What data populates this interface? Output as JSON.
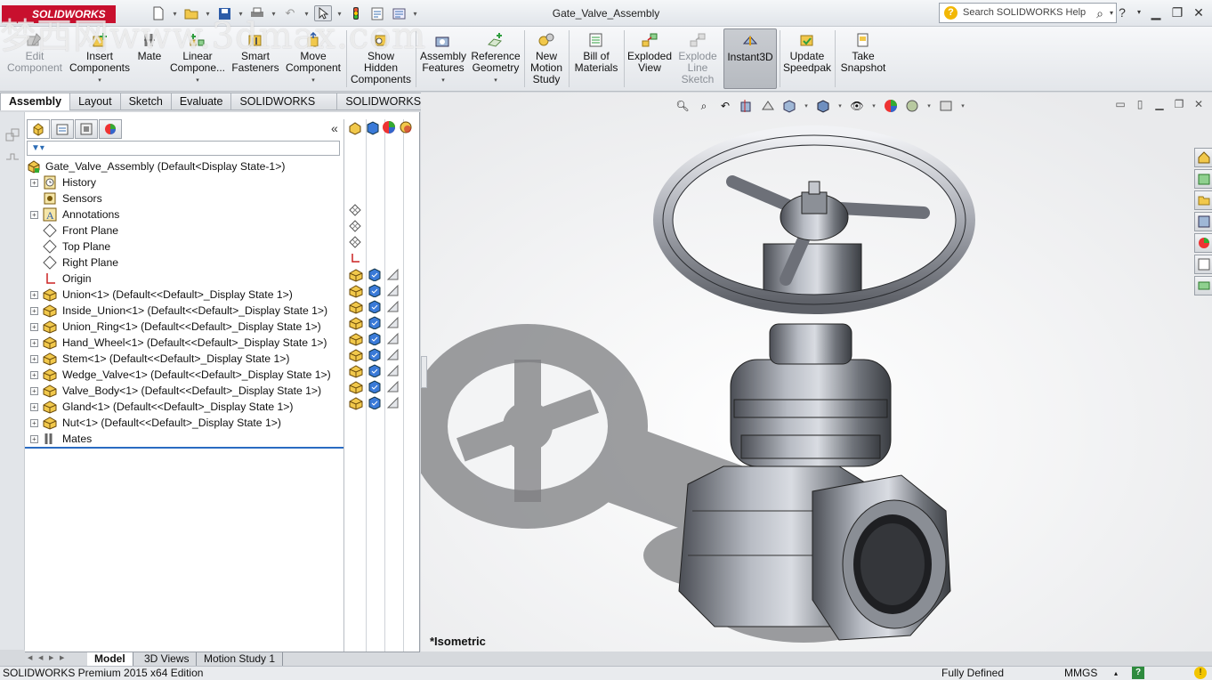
{
  "window": {
    "title": "Gate_Valve_Assembly",
    "logo_text": "SOLIDWORKS",
    "search_placeholder": "Search SOLIDWORKS Help",
    "watermark": "梦西网www.3dmax.com"
  },
  "quick_access": {
    "icons": [
      "new-icon",
      "open-icon",
      "save-icon",
      "print-icon",
      "undo-icon",
      "select-icon",
      "rebuild-icon",
      "file-properties-icon",
      "options-icon"
    ]
  },
  "command_manager": {
    "items": [
      {
        "label1": "Edit",
        "label2": "Component",
        "label3": "",
        "enabled": false,
        "dropdown": false
      },
      {
        "label1": "Insert",
        "label2": "Components",
        "label3": "",
        "enabled": true,
        "dropdown": true
      },
      {
        "label1": "Mate",
        "label2": "",
        "label3": "",
        "enabled": true,
        "dropdown": false
      },
      {
        "label1": "Linear",
        "label2": "Compone...",
        "label3": "",
        "enabled": true,
        "dropdown": true
      },
      {
        "label1": "Smart",
        "label2": "Fasteners",
        "label3": "",
        "enabled": true,
        "dropdown": false
      },
      {
        "label1": "Move",
        "label2": "Component",
        "label3": "",
        "enabled": true,
        "dropdown": true
      },
      {
        "label1": "Show",
        "label2": "Hidden",
        "label3": "Components",
        "enabled": true,
        "dropdown": false
      },
      {
        "label1": "Assembly",
        "label2": "Features",
        "label3": "",
        "enabled": true,
        "dropdown": true
      },
      {
        "label1": "Reference",
        "label2": "Geometry",
        "label3": "",
        "enabled": true,
        "dropdown": true
      },
      {
        "label1": "New",
        "label2": "Motion",
        "label3": "Study",
        "enabled": true,
        "dropdown": false
      },
      {
        "label1": "Bill of",
        "label2": "Materials",
        "label3": "",
        "enabled": true,
        "dropdown": false
      },
      {
        "label1": "Exploded",
        "label2": "View",
        "label3": "",
        "enabled": true,
        "dropdown": false
      },
      {
        "label1": "Explode",
        "label2": "Line",
        "label3": "Sketch",
        "enabled": false,
        "dropdown": false
      },
      {
        "label1": "Instant3D",
        "label2": "",
        "label3": "",
        "enabled": true,
        "dropdown": false,
        "active": true
      },
      {
        "label1": "Update",
        "label2": "Speedpak",
        "label3": "",
        "enabled": true,
        "dropdown": false
      },
      {
        "label1": "Take",
        "label2": "Snapshot",
        "label3": "",
        "enabled": true,
        "dropdown": false
      }
    ]
  },
  "tabs": [
    "Assembly",
    "Layout",
    "Sketch",
    "Evaluate",
    "SOLIDWORKS Add-Ins",
    "SOLIDWORKS MBD"
  ],
  "feature_tree": {
    "root": "Gate_Valve_Assembly  (Default<Display State-1>)",
    "nodes": [
      {
        "label": "History",
        "icon": "history-icon"
      },
      {
        "label": "Sensors",
        "icon": "sensor-icon"
      },
      {
        "label": "Annotations",
        "icon": "annotations-icon"
      },
      {
        "label": "Front Plane",
        "icon": "plane-icon"
      },
      {
        "label": "Top Plane",
        "icon": "plane-icon"
      },
      {
        "label": "Right Plane",
        "icon": "plane-icon"
      },
      {
        "label": "Origin",
        "icon": "origin-icon"
      },
      {
        "label": "Union<1> (Default<<Default>_Display State 1>)",
        "icon": "part-icon"
      },
      {
        "label": "Inside_Union<1> (Default<<Default>_Display State 1>)",
        "icon": "part-icon"
      },
      {
        "label": "Union_Ring<1> (Default<<Default>_Display State 1>)",
        "icon": "part-icon"
      },
      {
        "label": "Hand_Wheel<1> (Default<<Default>_Display State 1>)",
        "icon": "part-icon"
      },
      {
        "label": "Stem<1> (Default<<Default>_Display State 1>)",
        "icon": "part-icon"
      },
      {
        "label": "Wedge_Valve<1> (Default<<Default>_Display State 1>)",
        "icon": "part-icon"
      },
      {
        "label": "Valve_Body<1> (Default<<Default>_Display State 1>)",
        "icon": "part-icon"
      },
      {
        "label": "Gland<1> (Default<<Default>_Display State 1>)",
        "icon": "part-icon"
      },
      {
        "label": "Nut<1> (Default<<Default>_Display State 1>)",
        "icon": "part-icon"
      },
      {
        "label": "Mates",
        "icon": "mates-icon"
      }
    ]
  },
  "bottom_tabs": [
    "Model",
    "3D Views",
    "Motion Study 1"
  ],
  "viewport": {
    "view_label": "*Isometric"
  },
  "status": {
    "edition": "SOLIDWORKS Premium 2015 x64 Edition",
    "state": "Fully Defined",
    "units": "MMGS"
  },
  "colors": {
    "brand_red": "#c8102e",
    "selection_blue": "#2a6bc2",
    "part_yellow": "#e8b400"
  }
}
